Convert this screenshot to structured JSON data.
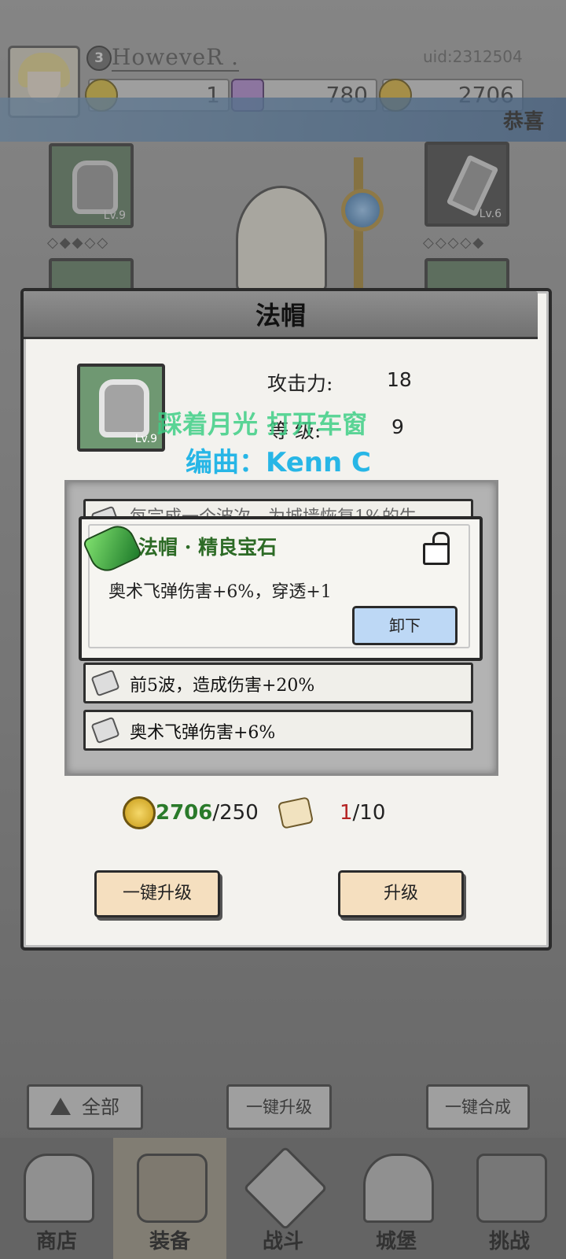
{
  "header": {
    "level": "3",
    "username": "HoweveR .",
    "uid": "uid:2312504",
    "resources": {
      "energy": "1",
      "gems": "780",
      "gold": "2706"
    }
  },
  "banner": {
    "text": "恭喜"
  },
  "equip_slots": [
    {
      "level": "Lv.9"
    },
    {
      "level": "Lv.6"
    }
  ],
  "modal": {
    "title": "法帽",
    "item_level": "Lv.9",
    "stats": {
      "attack_label": "攻击力:",
      "attack_value": "18",
      "level_label": "等  级:",
      "level_value": "9"
    },
    "overlay_song": "踩着月光 打开车窗",
    "overlay_composer": "编曲：Kenn C",
    "hidden_row_text": "每完成一个波次，为城墙恢复1%的生",
    "gem_card": {
      "title": "法帽 · 精良宝石",
      "description": "奥术飞弹伤害+6%，穿透+1",
      "unequip_label": "卸下"
    },
    "affixes": [
      "前5波，造成伤害+20%",
      "奥术飞弹伤害+6%"
    ],
    "cost": {
      "gold_have": "2706",
      "gold_need": "/250",
      "scroll_have": "1",
      "scroll_need": "/10"
    },
    "btn_one_key_upgrade": "一键升级",
    "btn_upgrade": "升级"
  },
  "controls": {
    "filter_label": "全部",
    "one_key_upgrade": "一键升级",
    "one_key_merge": "一键合成"
  },
  "nav": [
    {
      "label": "商店",
      "active": false
    },
    {
      "label": "装备",
      "active": true
    },
    {
      "label": "战斗",
      "active": false
    },
    {
      "label": "城堡",
      "active": false
    },
    {
      "label": "挑战",
      "active": false
    }
  ]
}
